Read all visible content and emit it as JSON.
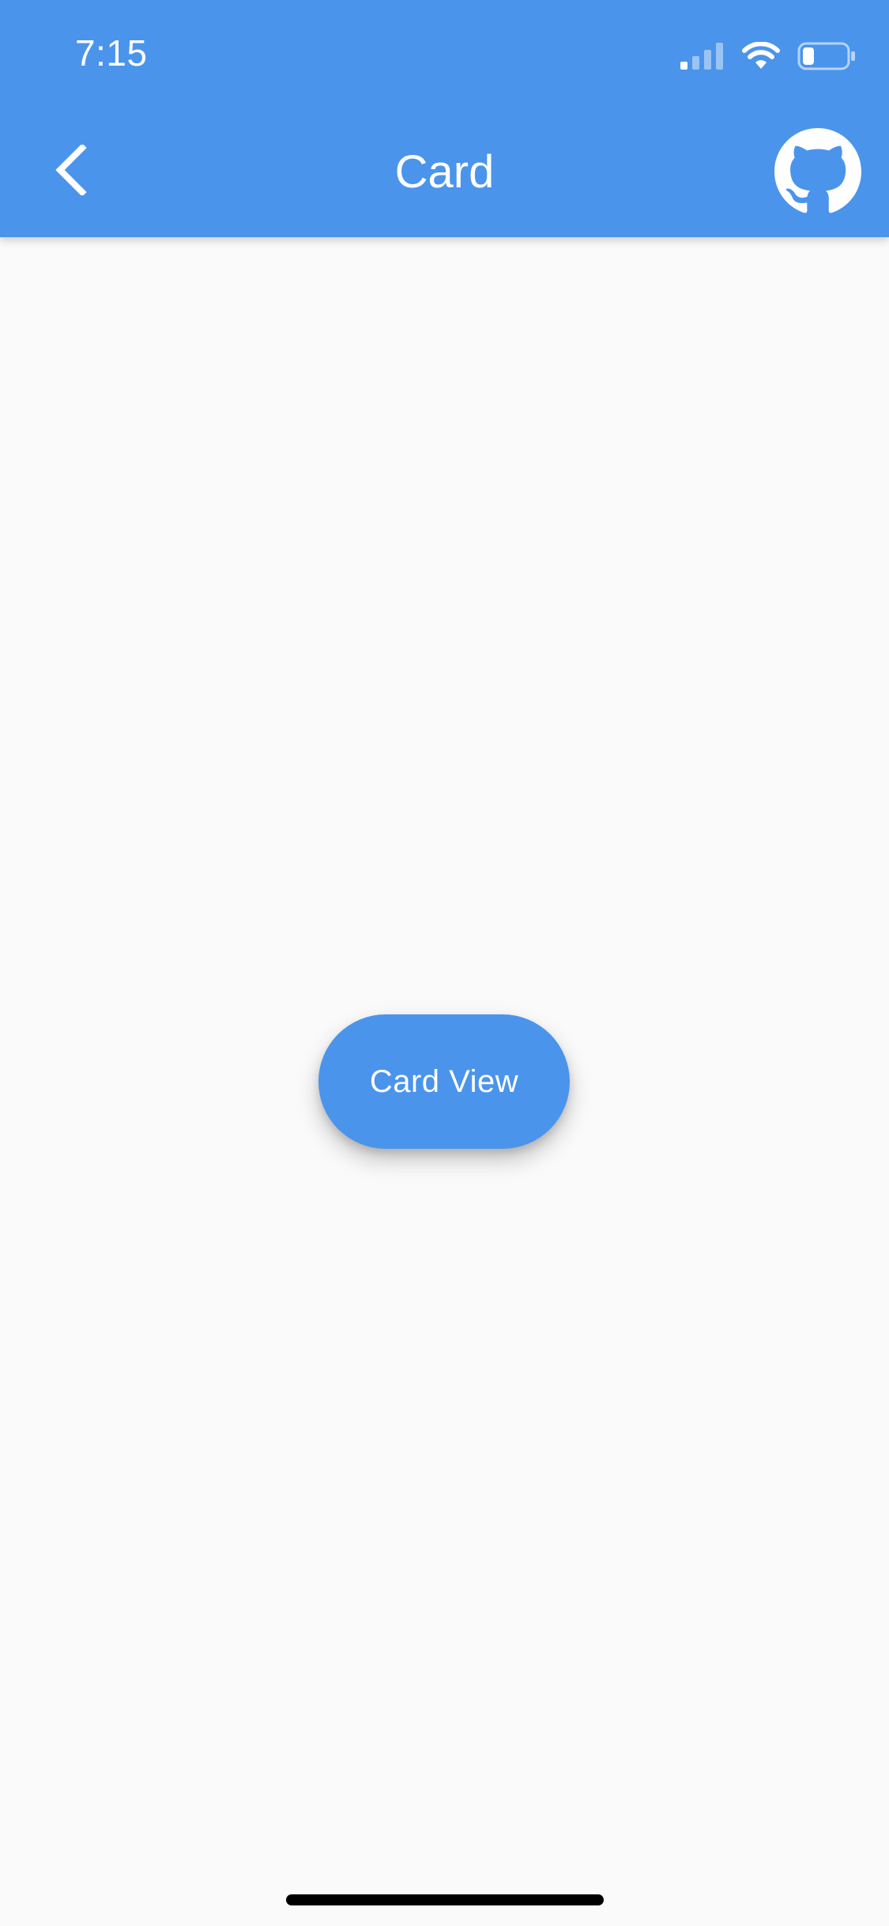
{
  "status_bar": {
    "time": "7:15"
  },
  "app_bar": {
    "title": "Card",
    "back_icon": "chevron-left-icon",
    "github_icon": "github-octocat-icon"
  },
  "main": {
    "card_button_label": "Card View"
  },
  "colors": {
    "primary": "#4a94ec",
    "background": "#fafafa",
    "on_primary": "#ffffff"
  }
}
